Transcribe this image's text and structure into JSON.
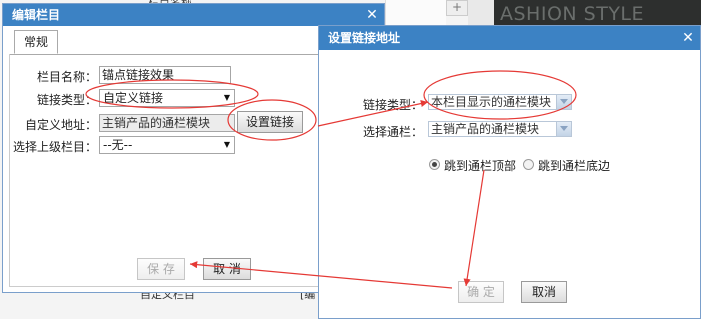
{
  "background": {
    "banner_text": "ASHION STYLE",
    "top_text": "栏目名称",
    "bottom_text": "自定义栏目",
    "bottom_red": "**",
    "bottom_bracket": "[编"
  },
  "edit_dialog": {
    "title": "编辑栏目",
    "close_glyph": "✕",
    "tab_label": "常规",
    "fields": {
      "name_label": "栏目名称：",
      "name_value": "锚点链接效果",
      "link_type_label": "链接类型：",
      "link_type_value": "自定义链接",
      "custom_url_label": "自定义地址：",
      "custom_url_value": "主销产品的通栏模块",
      "set_link_button": "设置链接",
      "parent_label": "选择上级栏目：",
      "parent_value": "--无--"
    },
    "save_button": "保 存",
    "cancel_button": "取 消"
  },
  "link_dialog": {
    "title": "设置链接地址",
    "close_glyph": "✕",
    "link_type_label": "链接类型：",
    "link_type_value": "本栏目显示的通栏模块",
    "section_label": "选择通栏：",
    "section_value": "主销产品的通栏模块",
    "radio_top": "跳到通栏顶部",
    "radio_bottom": "跳到通栏底边",
    "confirm_button": "确 定",
    "cancel_button": "取消"
  },
  "colors": {
    "title_bar": "#3c82c4",
    "annotation_red": "#e53935"
  }
}
